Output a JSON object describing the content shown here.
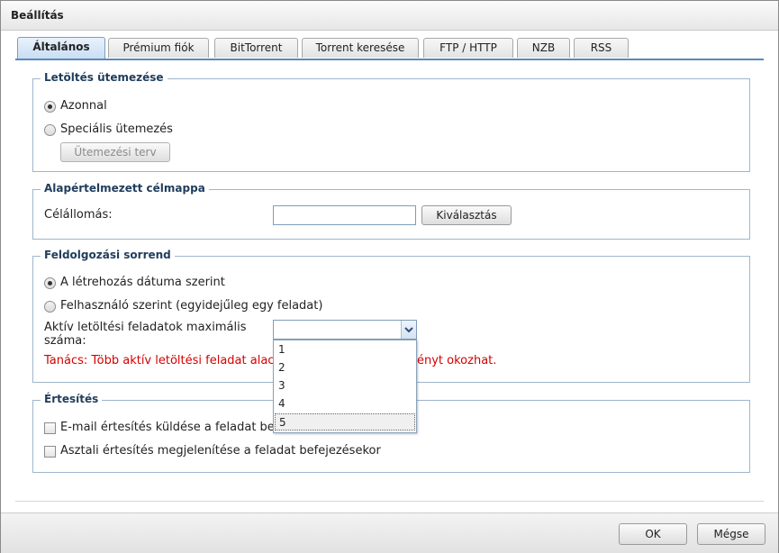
{
  "window": {
    "title": "Beállítás"
  },
  "tabs": [
    {
      "label": "Általános",
      "active": true
    },
    {
      "label": "Prémium fiók"
    },
    {
      "label": "BitTorrent"
    },
    {
      "label": "Torrent keresése"
    },
    {
      "label": "FTP / HTTP"
    },
    {
      "label": "NZB"
    },
    {
      "label": "RSS"
    }
  ],
  "schedule": {
    "legend": "Letöltés ütemezése",
    "option_immediate": "Azonnal",
    "option_custom": "Speciális ütemezés",
    "plan_button": "Ütemezési terv",
    "selected": "Azonnal"
  },
  "destination": {
    "legend": "Alapértelmezett célmappa",
    "label": "Célállomás:",
    "value": "",
    "browse_button": "Kiválasztás"
  },
  "processing": {
    "legend": "Feldolgozási sorrend",
    "option_date": "A létrehozás dátuma szerint",
    "option_user": "Felhasználó szerint (egyidejűleg egy feladat)",
    "selected": "A létrehozás dátuma szerint",
    "max_label_line1": "Aktív letöltési feladatok maximális",
    "max_label_line2": "száma:",
    "max_value": "",
    "dropdown_options": [
      "1",
      "2",
      "3",
      "4",
      "5"
    ],
    "hovered_option": "5",
    "warning_left": "Tanács: Több aktív letöltési feladat alacs",
    "warning_right": "ényt okozhat."
  },
  "notification": {
    "legend": "Értesítés",
    "email_label": "E-mail értesítés küldése a feladat befej",
    "desktop_label": "Asztali értesítés megjelenítése a feladat befejezésekor",
    "email_checked": false,
    "desktop_checked": false
  },
  "footer": {
    "ok": "OK",
    "cancel": "Mégse"
  },
  "colors": {
    "accent": "#5b89b8",
    "legend_text": "#1f3d5c",
    "warning": "#d40000"
  }
}
